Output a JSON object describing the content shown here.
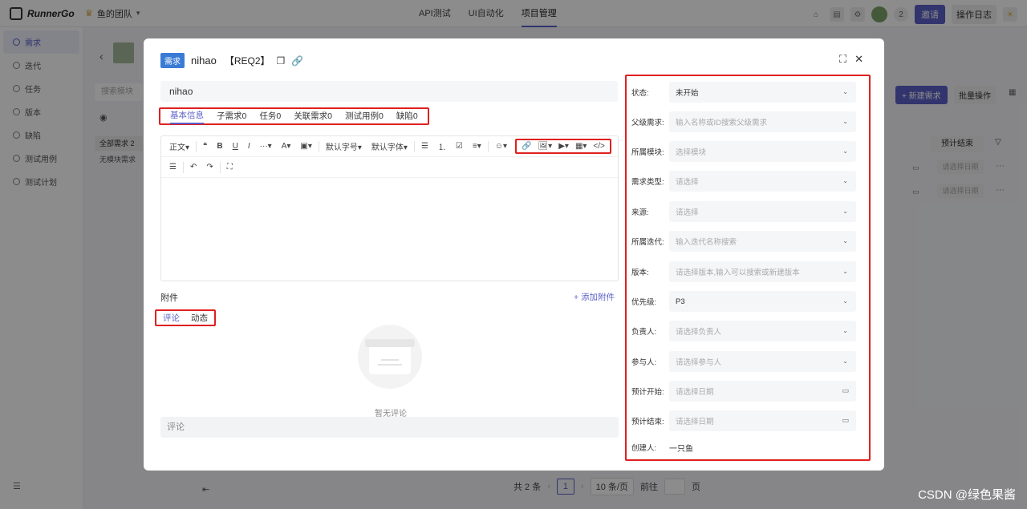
{
  "app": {
    "logo_text": "RunnerGo",
    "team_name": "鱼的团队",
    "nav": [
      "API测试",
      "UI自动化",
      "项目管理"
    ],
    "nav_active": "项目管理",
    "member_count": "2",
    "invite_label": "邀请",
    "oplog_label": "操作日志"
  },
  "sidebar": {
    "items": [
      {
        "label": "需求",
        "active": true
      },
      {
        "label": "迭代",
        "active": false
      },
      {
        "label": "任务",
        "active": false
      },
      {
        "label": "版本",
        "active": false
      },
      {
        "label": "缺陷",
        "active": false
      },
      {
        "label": "测试用例",
        "active": false
      },
      {
        "label": "测试计划",
        "active": false
      }
    ]
  },
  "background": {
    "search_placeholder": "搜索模块",
    "list_all": "全部需求 2",
    "list_nomodule": "无模块需求",
    "new_req_label": "+ 新建需求",
    "batch_label": "批量操作",
    "col_planned_end": "预计结束",
    "date_placeholder": "请选择日期",
    "pager_total": "共 2 条",
    "pager_page": "1",
    "pager_size": "10 条/页",
    "pager_goto": "前往",
    "pager_unit": "页"
  },
  "modal": {
    "tag": "需求",
    "title": "nihao",
    "code": "【REQ2】",
    "name_value": "nihao",
    "tabs": [
      "基本信息",
      "子需求0",
      "任务0",
      "关联需求0",
      "测试用例0",
      "缺陷0"
    ],
    "active_tab": "基本信息",
    "toolbar_row1": [
      "正文",
      "❝",
      "B",
      "U",
      "I",
      "···",
      "A",
      "▣",
      "默认字号",
      "默认字体",
      "☰",
      "⒈",
      "☑",
      "≡",
      "☺"
    ],
    "toolbar_highlight": [
      "🔗",
      "🖼",
      "▶",
      "▦",
      "</>"
    ],
    "toolbar_row2": [
      "☰",
      "↶",
      "↷",
      "⛶"
    ],
    "attach_label": "附件",
    "add_attach_label": "+ 添加附件",
    "comment_tabs": [
      "评论",
      "动态"
    ],
    "active_comment_tab": "评论",
    "empty_text": "暂无评论",
    "comment_placeholder": "评论"
  },
  "properties": [
    {
      "label": "状态:",
      "value": "未开始",
      "filled": true,
      "type": "select"
    },
    {
      "label": "父级需求:",
      "value": "输入名称或ID搜索父级需求",
      "filled": false,
      "type": "select"
    },
    {
      "label": "所属模块:",
      "value": "选择模块",
      "filled": false,
      "type": "select"
    },
    {
      "label": "需求类型:",
      "value": "请选择",
      "filled": false,
      "type": "select"
    },
    {
      "label": "来源:",
      "value": "请选择",
      "filled": false,
      "type": "select"
    },
    {
      "label": "所属迭代:",
      "value": "输入迭代名称搜索",
      "filled": false,
      "type": "select"
    },
    {
      "label": "版本:",
      "value": "请选择版本,输入可以搜索或新建版本",
      "filled": false,
      "type": "select"
    },
    {
      "label": "优先级:",
      "value": "P3",
      "filled": true,
      "type": "select"
    },
    {
      "label": "负责人:",
      "value": "请选择负责人",
      "filled": false,
      "type": "select"
    },
    {
      "label": "参与人:",
      "value": "请选择参与人",
      "filled": false,
      "type": "select"
    },
    {
      "label": "预计开始:",
      "value": "请选择日期",
      "filled": false,
      "type": "date"
    },
    {
      "label": "预计结束:",
      "value": "请选择日期",
      "filled": false,
      "type": "date"
    }
  ],
  "creator": {
    "label": "创建人:",
    "value": "一只鱼"
  },
  "watermark": "CSDN @绿色果酱",
  "colors": {
    "accent": "#5b5fc7",
    "highlight_box": "#e02020",
    "tag_blue": "#3a7bd5"
  }
}
